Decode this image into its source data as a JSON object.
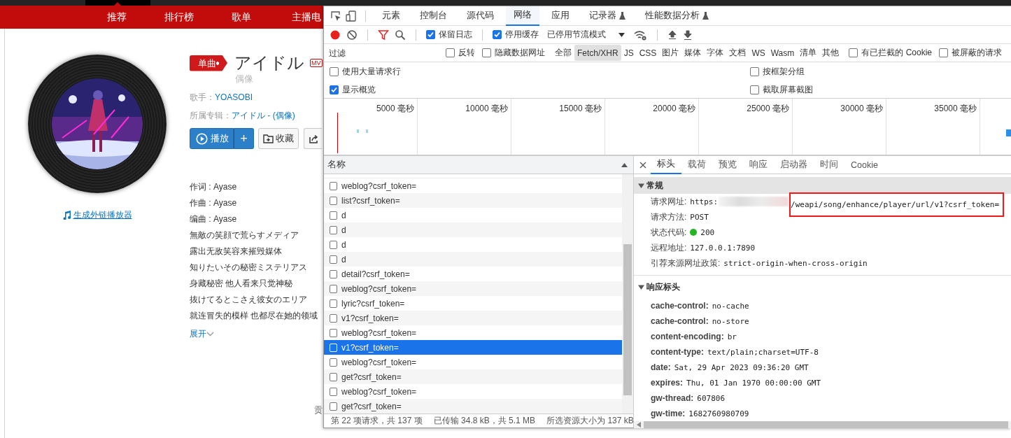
{
  "page": {
    "nav": [
      {
        "label": "推荐"
      },
      {
        "label": "排行榜"
      },
      {
        "label": "歌单"
      },
      {
        "label": "主播电"
      }
    ],
    "embed_link": "生成外链播放器",
    "song": {
      "tag": "单曲",
      "title": "アイドル",
      "mv_badge": "MV",
      "subtitle": "偶像",
      "artist_label": "歌手：",
      "artist": "YOASOBI",
      "album_label": "所属专辑：",
      "album": "アイドル - (偶像)"
    },
    "actions": {
      "play": "播放",
      "add": "+",
      "collect": "收藏"
    },
    "lyrics": [
      "作词 : Ayase",
      "作曲 : Ayase",
      "编曲 : Ayase",
      "無敵の笑顔で荒らすメディア",
      "露出无敌笑容来摧毁媒体",
      "知りたいその秘密ミステリアス",
      "身藏秘密 他人看来只觉神秘",
      "抜けてるとこさえ彼女のエリア",
      "就连冒失的模样 也都尽在她的领域"
    ],
    "expand": "展开",
    "footer_fragment": "贡"
  },
  "devtools": {
    "tabs": [
      {
        "label": "元素",
        "selected": false,
        "experimental": false
      },
      {
        "label": "控制台",
        "selected": false,
        "experimental": false
      },
      {
        "label": "源代码",
        "selected": false,
        "experimental": false
      },
      {
        "label": "网络",
        "selected": true,
        "experimental": false
      },
      {
        "label": "应用",
        "selected": false,
        "experimental": false
      },
      {
        "label": "记录器",
        "selected": false,
        "experimental": true
      },
      {
        "label": "性能数据分析",
        "selected": false,
        "experimental": true
      }
    ],
    "toolbar": {
      "recording": true,
      "filter_active": true,
      "preserve_log": {
        "label": "保留日志",
        "checked": true
      },
      "disable_cache": {
        "label": "停用缓存",
        "checked": true
      },
      "throttle": "已停用节流模式"
    },
    "filter": {
      "placeholder": "过滤",
      "invert": {
        "label": "反转",
        "checked": false
      },
      "hide_data_urls": {
        "label": "隐藏数据网址",
        "checked": false
      },
      "types": [
        {
          "label": "全部",
          "selected": false
        },
        {
          "label": "Fetch/XHR",
          "selected": true
        },
        {
          "label": "JS",
          "selected": false
        },
        {
          "label": "CSS",
          "selected": false
        },
        {
          "label": "图片",
          "selected": false
        },
        {
          "label": "媒体",
          "selected": false
        },
        {
          "label": "字体",
          "selected": false
        },
        {
          "label": "文档",
          "selected": false
        },
        {
          "label": "WS",
          "selected": false
        },
        {
          "label": "Wasm",
          "selected": false
        },
        {
          "label": "清单",
          "selected": false
        },
        {
          "label": "其他",
          "selected": false
        }
      ],
      "blocked_cookies": {
        "label": "有已拦截的 Cookie",
        "checked": false
      },
      "blocked_requests": {
        "label": "被屏蔽的请求",
        "checked": false
      }
    },
    "options": [
      {
        "label": "使用大量请求行",
        "checked": false
      },
      {
        "label": "按框架分组",
        "checked": false
      },
      {
        "label": "显示概览",
        "checked": true
      },
      {
        "label": "截取屏幕截图",
        "checked": false
      }
    ],
    "timeline": {
      "ticks": [
        "5000 毫秒",
        "10000 毫秒",
        "15000 毫秒",
        "20000 毫秒",
        "25000 毫秒",
        "30000 毫秒",
        "35000 毫秒"
      ]
    },
    "requests": {
      "header": "名称",
      "rows": [
        {
          "name": "weblog?csrf_token=",
          "selected": false
        },
        {
          "name": "list?csrf_token=",
          "selected": false
        },
        {
          "name": "d",
          "selected": false
        },
        {
          "name": "d",
          "selected": false
        },
        {
          "name": "d",
          "selected": false
        },
        {
          "name": "d",
          "selected": false
        },
        {
          "name": "detail?csrf_token=",
          "selected": false
        },
        {
          "name": "weblog?csrf_token=",
          "selected": false
        },
        {
          "name": "lyric?csrf_token=",
          "selected": false
        },
        {
          "name": "v1?csrf_token=",
          "selected": false
        },
        {
          "name": "weblog?csrf_token=",
          "selected": false
        },
        {
          "name": "v1?csrf_token=",
          "selected": true
        },
        {
          "name": "weblog?csrf_token=",
          "selected": false
        },
        {
          "name": "get?csrf_token=",
          "selected": false
        },
        {
          "name": "weblog?csrf_token=",
          "selected": false
        },
        {
          "name": "get?csrf_token=",
          "selected": false
        }
      ]
    },
    "summary": [
      "第 22 项请求，共 137 项",
      "已传输 34.8 kB，共 5.1 MB",
      "所选资源大小为 137 kB"
    ],
    "details": {
      "tabs": [
        {
          "label": "标头",
          "selected": true
        },
        {
          "label": "载荷",
          "selected": false
        },
        {
          "label": "预览",
          "selected": false
        },
        {
          "label": "响应",
          "selected": false
        },
        {
          "label": "启动器",
          "selected": false
        },
        {
          "label": "时间",
          "selected": false
        },
        {
          "label": "Cookie",
          "selected": false
        }
      ],
      "sections": [
        {
          "title": "常规",
          "kind": "general",
          "expanded": true,
          "rows": [
            {
              "key": "请求网址:",
              "value": "https:",
              "redacted": true,
              "value_tail": "/weapi/song/enhance/player/url/v1?csrf_token=",
              "highlighted": true
            },
            {
              "key": "请求方法:",
              "value": "POST"
            },
            {
              "key": "状态代码:",
              "value": "200",
              "color": "#22b422"
            },
            {
              "key": "远程地址:",
              "value": "127.0.0.1:7890"
            },
            {
              "key": "引荐来源网址政策:",
              "value": "strict-origin-when-cross-origin"
            }
          ]
        },
        {
          "title": "响应标头",
          "kind": "headers",
          "expanded": true,
          "rows": [
            {
              "key": "cache-control:",
              "value": "no-cache"
            },
            {
              "key": "cache-control:",
              "value": "no-store"
            },
            {
              "key": "content-encoding:",
              "value": "br"
            },
            {
              "key": "content-type:",
              "value": "text/plain;charset=UTF-8"
            },
            {
              "key": "date:",
              "value": "Sat, 29 Apr 2023 09:36:20 GMT"
            },
            {
              "key": "expires:",
              "value": "Thu, 01 Jan 1970 00:00:00 GMT"
            },
            {
              "key": "gw-thread:",
              "value": "607806"
            },
            {
              "key": "gw-time:",
              "value": "1682760980709"
            }
          ]
        }
      ]
    }
  }
}
